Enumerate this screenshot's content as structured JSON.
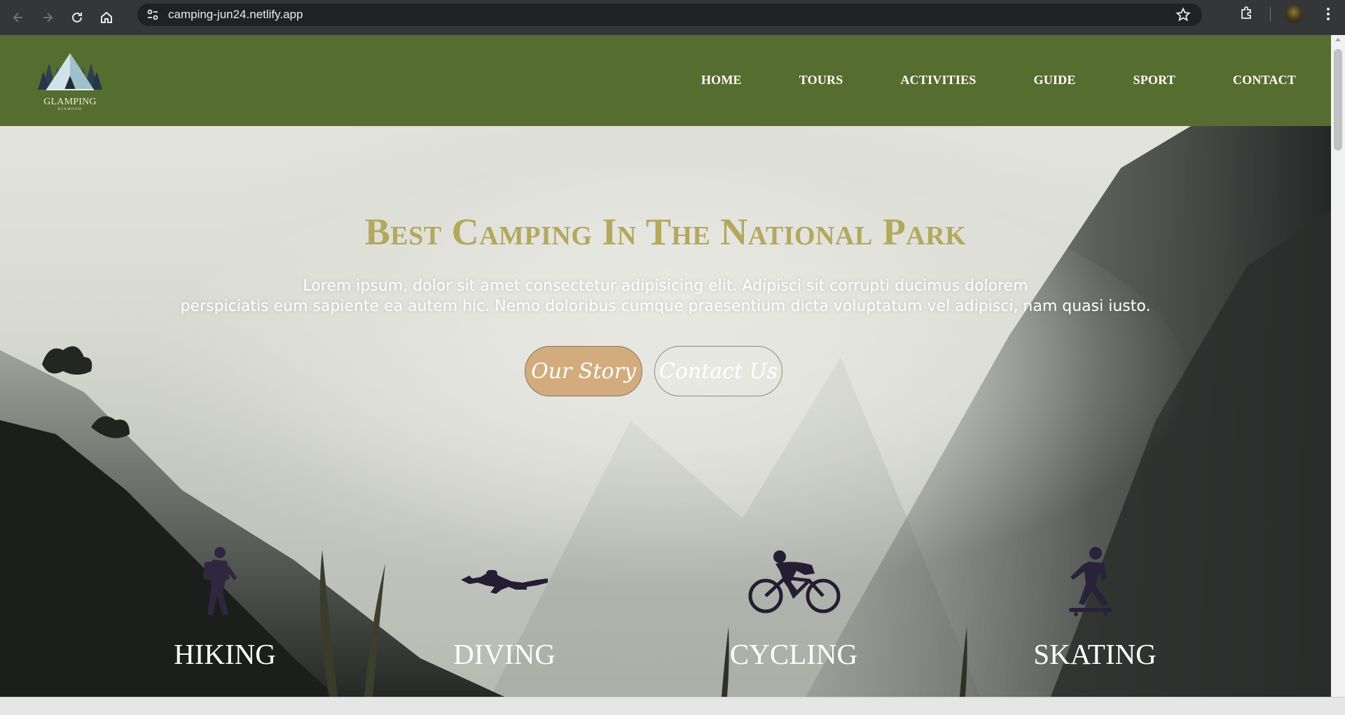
{
  "browser": {
    "url": "camping-jun24.netlify.app"
  },
  "header": {
    "logo_text": "GLAMPING",
    "logo_sub": "DIAMOND",
    "menu": [
      "HOME",
      "TOURS",
      "ACTIVITIES",
      "GUIDE",
      "SPORT",
      "CONTACT"
    ],
    "color": "#566d30"
  },
  "hero": {
    "title": "Best Camping In The National Park",
    "text_line1": "Lorem ipsum, dolor sit amet consectetur adipisicing elit. Adipisci sit corrupti ducimus dolorem",
    "text_line2": "perspiciatis eum sapiente ea autem hic. Nemo doloribus cumque praesentium dicta voluptatum vel adipisci, nam quasi iusto.",
    "btn_story": "Our Story",
    "btn_contact": "Contact Us",
    "title_color": "#b3a85c",
    "story_btn_color": "#d3ac7e"
  },
  "activities": [
    {
      "label": "HIKING",
      "icon": "hiker-icon"
    },
    {
      "label": "DIVING",
      "icon": "diver-icon"
    },
    {
      "label": "CYCLING",
      "icon": "cyclist-icon"
    },
    {
      "label": "SKATING",
      "icon": "skater-icon"
    }
  ]
}
